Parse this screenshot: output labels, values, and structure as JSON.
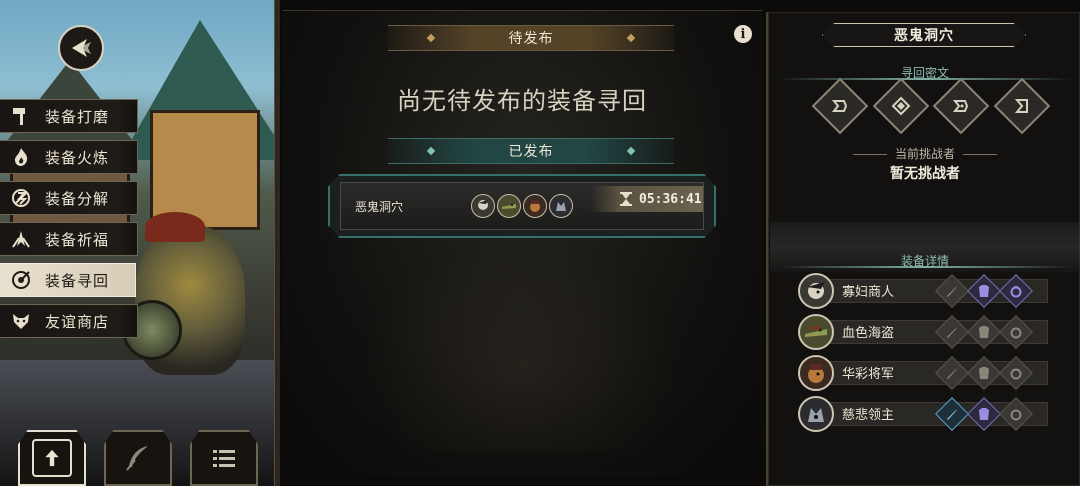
{
  "menu": {
    "items": [
      {
        "label": "装备打磨",
        "icon": "hammer-icon"
      },
      {
        "label": "装备火炼",
        "icon": "flame-icon"
      },
      {
        "label": "装备分解",
        "icon": "disassemble-icon"
      },
      {
        "label": "装备祈福",
        "icon": "pray-icon"
      },
      {
        "label": "装备寻回",
        "icon": "retrieve-icon",
        "active": true
      },
      {
        "label": "友谊商店",
        "icon": "fox-shop-icon"
      }
    ]
  },
  "center": {
    "pending_header": "待发布",
    "empty_message": "尚无待发布的装备寻回",
    "published_header": "已发布",
    "published_card": {
      "title": "恶鬼洞穴",
      "timer": "05:36:41",
      "avatars": [
        "widow-merchant-avatar",
        "crocodile-avatar",
        "general-avatar",
        "lord-avatar"
      ]
    }
  },
  "right": {
    "title": "恶鬼洞穴",
    "runes_header": "寻回密文",
    "challenger_header": "当前挑战者",
    "challenger_value": "暂无挑战者",
    "equip_header": "装备详情",
    "equipment": [
      {
        "name": "寡妇商人",
        "slots": [
          "weapon-off",
          "armor-on",
          "ring-on"
        ]
      },
      {
        "name": "血色海盗",
        "slots": [
          "weapon-off",
          "armor-off",
          "ring-off"
        ]
      },
      {
        "name": "华彩将军",
        "slots": [
          "weapon-off",
          "armor-off",
          "ring-off"
        ]
      },
      {
        "name": "慈悲领主",
        "slots": [
          "weapon-on",
          "armor-on",
          "ring-off"
        ]
      }
    ]
  },
  "colors": {
    "teal_accent": "#35706b",
    "gold_accent": "#c4a060",
    "active_menu_bg": "#e9e1cf",
    "slot_purple": "#7a6db5",
    "slot_blue": "#5aa4c9"
  }
}
